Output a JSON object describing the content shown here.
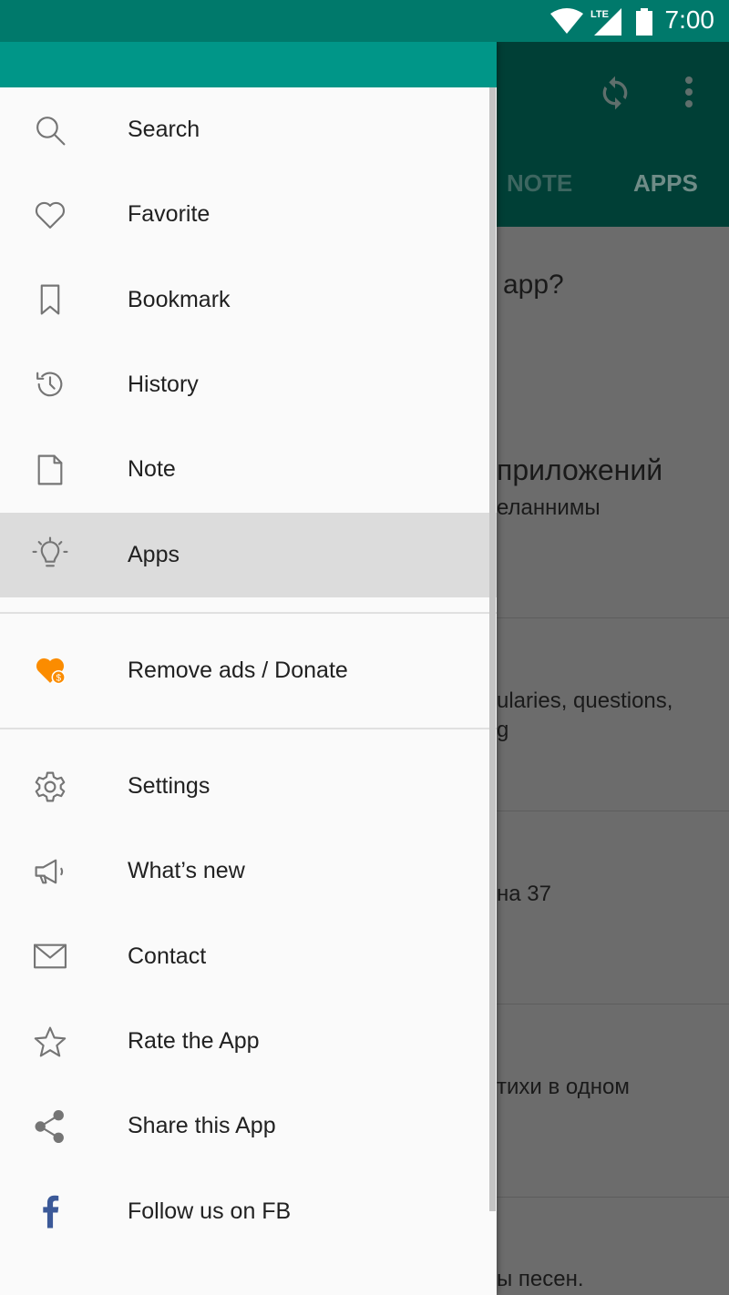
{
  "status_bar": {
    "time": "7:00",
    "icons": [
      "wifi-icon",
      "lte-signal-icon",
      "battery-icon"
    ],
    "network": "LTE"
  },
  "toolbar": {
    "icons": [
      "refresh-icon",
      "more-vert-icon"
    ],
    "tabs": [
      {
        "label": "NOTE"
      },
      {
        "label": "APPS"
      }
    ]
  },
  "background_content": {
    "texts": [
      "app?",
      "приложений",
      "еланнимы",
      "ularies, questions,",
      "g",
      "на 37",
      "тихи в одном",
      "ы песен."
    ]
  },
  "drawer": {
    "header_color": "#009688",
    "groups": [
      [
        {
          "label": "Search",
          "icon": "search-icon"
        },
        {
          "label": "Favorite",
          "icon": "heart-icon"
        },
        {
          "label": "Bookmark",
          "icon": "bookmark-icon"
        },
        {
          "label": "History",
          "icon": "history-icon"
        },
        {
          "label": "Note",
          "icon": "note-icon"
        },
        {
          "label": "Apps",
          "icon": "lightbulb-icon",
          "selected": true
        }
      ],
      [
        {
          "label": "Remove ads / Donate",
          "icon": "donate-heart-icon",
          "color": "#fb8c00"
        }
      ],
      [
        {
          "label": "Settings",
          "icon": "gear-icon"
        },
        {
          "label": "What’s new",
          "icon": "megaphone-icon"
        },
        {
          "label": "Contact",
          "icon": "mail-icon"
        },
        {
          "label": "Rate the App",
          "icon": "star-icon"
        },
        {
          "label": "Share this App",
          "icon": "share-icon"
        },
        {
          "label": "Follow us on FB",
          "icon": "facebook-icon",
          "color": "#3b5998"
        }
      ]
    ]
  }
}
